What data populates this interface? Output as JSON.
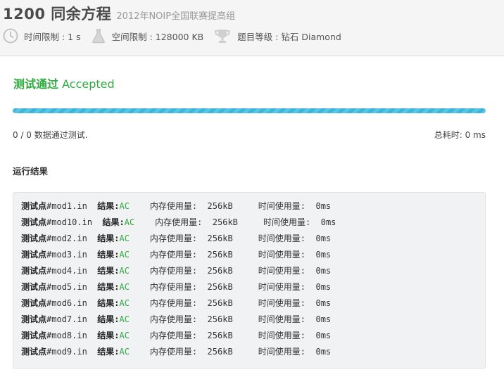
{
  "problem": {
    "title": "1200 同余方程",
    "subtitle": "2012年NOIP全国联赛提高组",
    "time_limit": "时间限制 : 1 s",
    "memory_limit": "空间限制 : 128000 KB",
    "level": "题目等级 : 钻石 Diamond"
  },
  "result": {
    "status_cn": "测试通过",
    "status_en": "Accepted",
    "progress_pct": 100,
    "passed": "0 / 0 数据通过测试.",
    "total_time": "总耗时: 0 ms"
  },
  "run_results_title": "运行结果",
  "labels": {
    "case": "测试点",
    "result": "结果:",
    "memory": "内存使用量:",
    "time": "时间使用量:"
  },
  "test_cases": [
    {
      "file": "#mod1.in",
      "verdict": "AC",
      "memory": "256kB",
      "time": "0ms"
    },
    {
      "file": "#mod10.in",
      "verdict": "AC",
      "memory": "256kB",
      "time": "0ms"
    },
    {
      "file": "#mod2.in",
      "verdict": "AC",
      "memory": "256kB",
      "time": "0ms"
    },
    {
      "file": "#mod3.in",
      "verdict": "AC",
      "memory": "256kB",
      "time": "0ms"
    },
    {
      "file": "#mod4.in",
      "verdict": "AC",
      "memory": "256kB",
      "time": "0ms"
    },
    {
      "file": "#mod5.in",
      "verdict": "AC",
      "memory": "256kB",
      "time": "0ms"
    },
    {
      "file": "#mod6.in",
      "verdict": "AC",
      "memory": "256kB",
      "time": "0ms"
    },
    {
      "file": "#mod7.in",
      "verdict": "AC",
      "memory": "256kB",
      "time": "0ms"
    },
    {
      "file": "#mod8.in",
      "verdict": "AC",
      "memory": "256kB",
      "time": "0ms"
    },
    {
      "file": "#mod9.in",
      "verdict": "AC",
      "memory": "256kB",
      "time": "0ms"
    }
  ],
  "colors": {
    "accent_green": "#2eaa3f",
    "progress_blue": "#3ab6da"
  },
  "icons": [
    "clock-icon",
    "flask-icon",
    "trophy-icon"
  ]
}
